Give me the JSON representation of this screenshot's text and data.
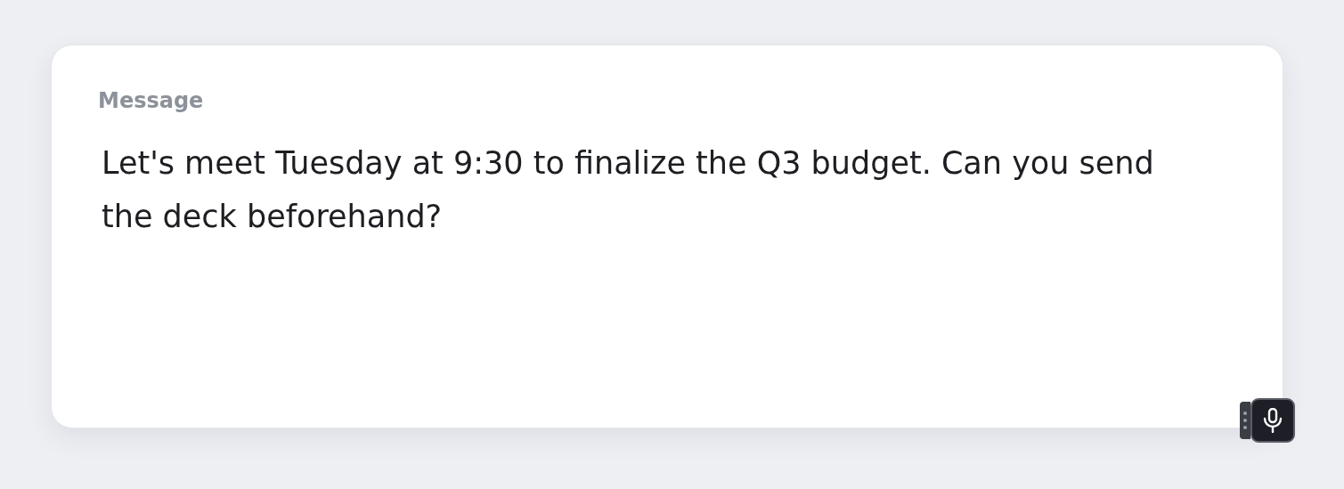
{
  "field": {
    "label": "Message",
    "value": "Let's meet Tuesday at 9:30 to finalize the Q3 budget. Can you send the deck beforehand?"
  }
}
